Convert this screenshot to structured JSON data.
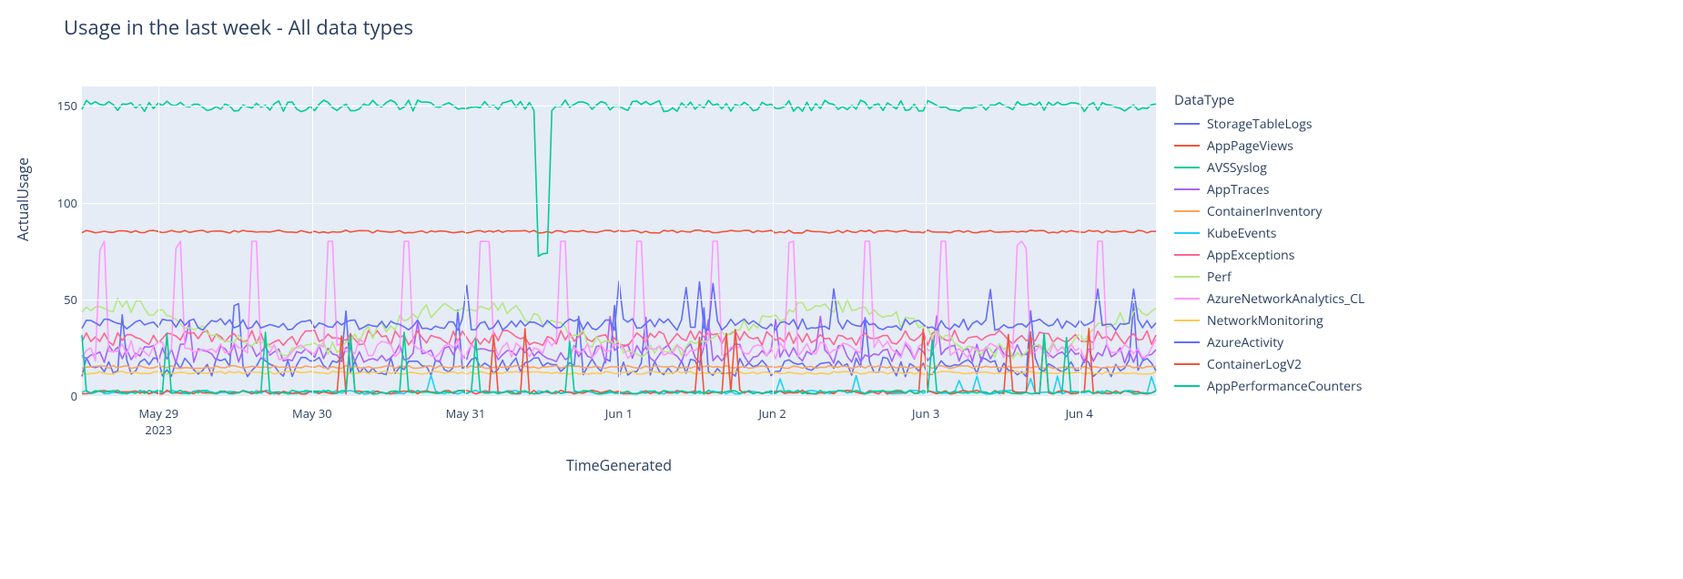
{
  "title": "Usage in the last week - All data types",
  "ylabel": "ActualUsage",
  "xlabel": "TimeGenerated",
  "legend_title": "DataType",
  "yticks": [
    0,
    50,
    100,
    150
  ],
  "xticks": [
    {
      "label": "May 29",
      "sub": "2023"
    },
    {
      "label": "May 30",
      "sub": ""
    },
    {
      "label": "May 31",
      "sub": ""
    },
    {
      "label": "Jun 1",
      "sub": ""
    },
    {
      "label": "Jun 2",
      "sub": ""
    },
    {
      "label": "Jun 3",
      "sub": ""
    },
    {
      "label": "Jun 4",
      "sub": ""
    }
  ],
  "chart_data": {
    "type": "line",
    "xlabel": "TimeGenerated",
    "ylabel": "ActualUsage",
    "title": "Usage in the last week - All data types",
    "ylim": [
      0,
      160
    ],
    "x_range": [
      "2023-05-28 12:00",
      "2023-06-04 12:00"
    ],
    "series": [
      {
        "name": "StorageTableLogs",
        "color": "#636efa",
        "approx_range": [
          5,
          45
        ],
        "baseline": 20
      },
      {
        "name": "AppPageViews",
        "color": "#ef553b",
        "approx_range": [
          83,
          86
        ],
        "baseline": 85
      },
      {
        "name": "AVSSyslog",
        "color": "#00cc96",
        "approx_range": [
          70,
          158
        ],
        "baseline": 150,
        "dip_at": "2023-05-31 12:00",
        "dip_value": 72
      },
      {
        "name": "AppTraces",
        "color": "#ab63fa",
        "approx_range": [
          15,
          40
        ],
        "baseline": 25
      },
      {
        "name": "ContainerInventory",
        "color": "#ffa15a",
        "approx_range": [
          14,
          16
        ],
        "baseline": 15
      },
      {
        "name": "KubeEvents",
        "color": "#19d3f3",
        "approx_range": [
          0,
          10
        ],
        "baseline": 2
      },
      {
        "name": "AppExceptions",
        "color": "#ff6692",
        "approx_range": [
          25,
          40
        ],
        "baseline": 32
      },
      {
        "name": "Perf",
        "color": "#b6e880",
        "approx_range": [
          15,
          55
        ],
        "baseline": 40
      },
      {
        "name": "AzureNetworkAnalytics_CL",
        "color": "#ff97ff",
        "approx_range": [
          10,
          80
        ],
        "baseline": 25
      },
      {
        "name": "NetworkMonitoring",
        "color": "#fecb52",
        "approx_range": [
          11,
          14
        ],
        "baseline": 12
      },
      {
        "name": "AzureActivity",
        "color": "#636efa",
        "approx_range": [
          30,
          60
        ],
        "baseline": 38
      },
      {
        "name": "ContainerLogV2",
        "color": "#ef553b",
        "approx_range": [
          0,
          35
        ],
        "baseline": 2
      },
      {
        "name": "AppPerformanceCounters",
        "color": "#00cc96",
        "approx_range": [
          0,
          30
        ],
        "baseline": 3
      }
    ]
  }
}
